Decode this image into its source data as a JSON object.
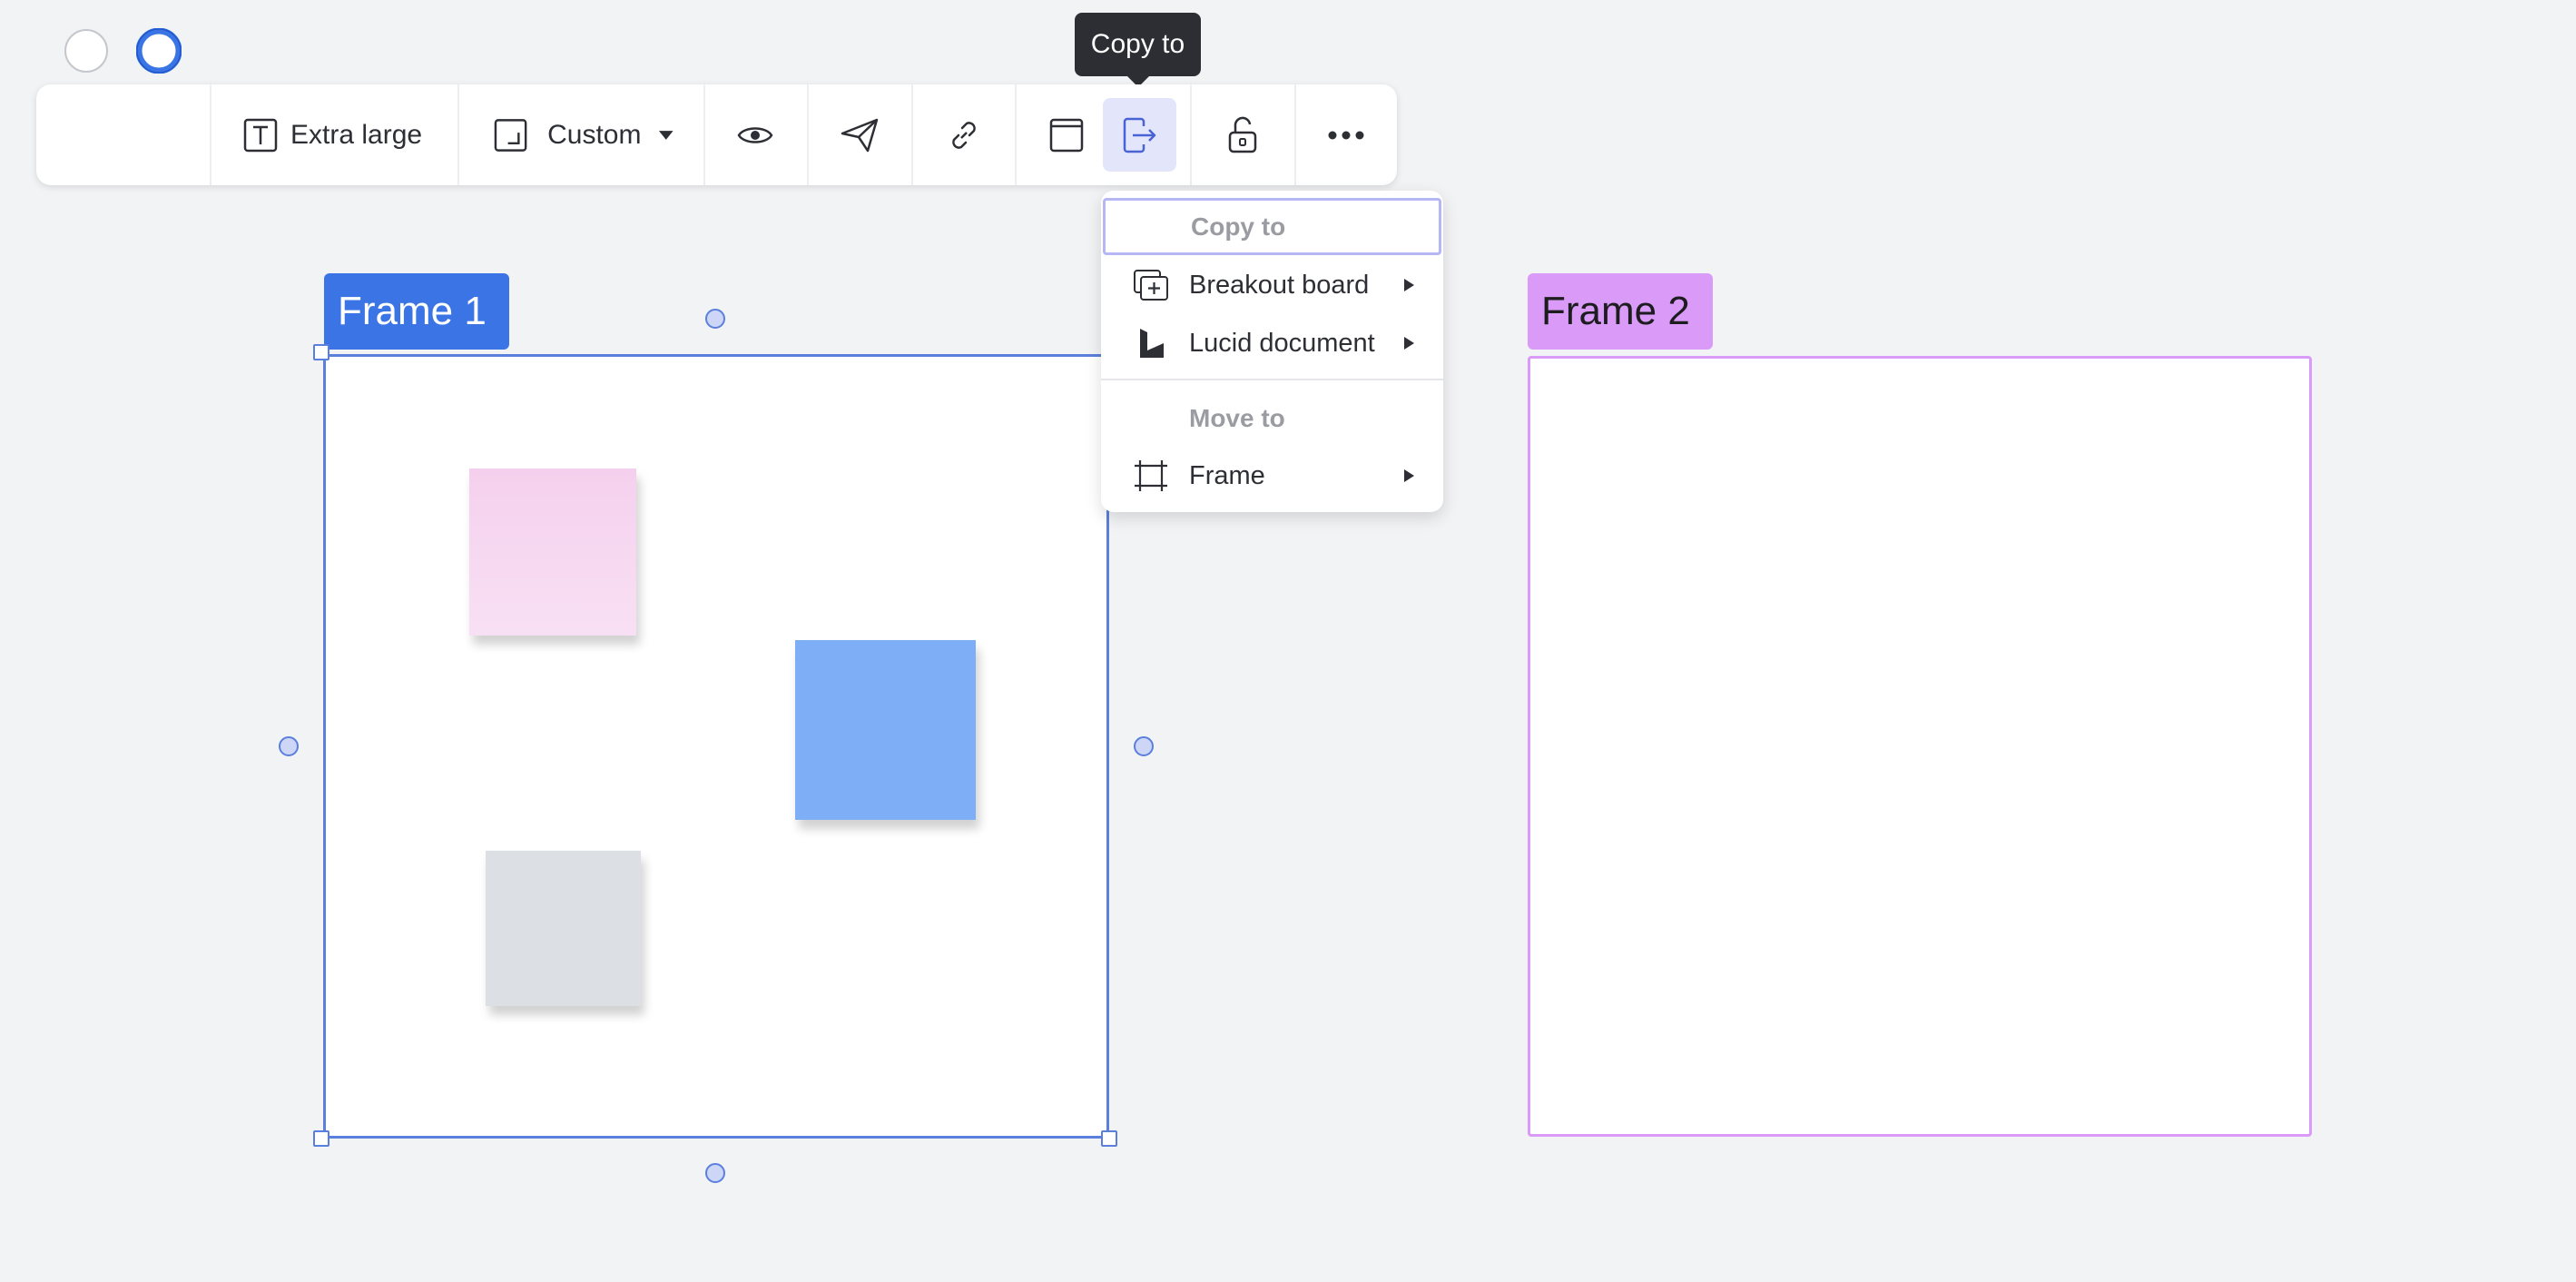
{
  "tooltip": {
    "text": "Copy to"
  },
  "toolbar": {
    "font_size_label": "Extra large",
    "size_label": "Custom",
    "icons": [
      "fill-color-icon",
      "border-color-icon",
      "text-icon",
      "resize-icon",
      "chevron-down-icon",
      "eye-icon",
      "send-icon",
      "link-icon",
      "window-icon",
      "copy-to-icon",
      "unlock-icon",
      "more-icon"
    ]
  },
  "frames": [
    {
      "label": "Frame 1",
      "color": "#3b74e4"
    },
    {
      "label": "Frame 2",
      "color": "#d99af8"
    }
  ],
  "stickies": [
    {
      "color": "#f5d0ee"
    },
    {
      "color": "#7eaef6"
    },
    {
      "color": "#dcdfe4"
    }
  ],
  "menu": {
    "copy_header": "Copy to",
    "copy_items": [
      {
        "label": "Breakout board",
        "icon": "breakout-board-icon"
      },
      {
        "label": "Lucid document",
        "icon": "lucid-logo-icon"
      }
    ],
    "move_header": "Move to",
    "move_items": [
      {
        "label": "Frame",
        "icon": "frame-icon"
      }
    ]
  },
  "colors": {
    "accent": "#3b74e4",
    "selection": "#5b7fdc",
    "active_button": "#e3e6fb",
    "canvas": "#f2f3f5"
  }
}
